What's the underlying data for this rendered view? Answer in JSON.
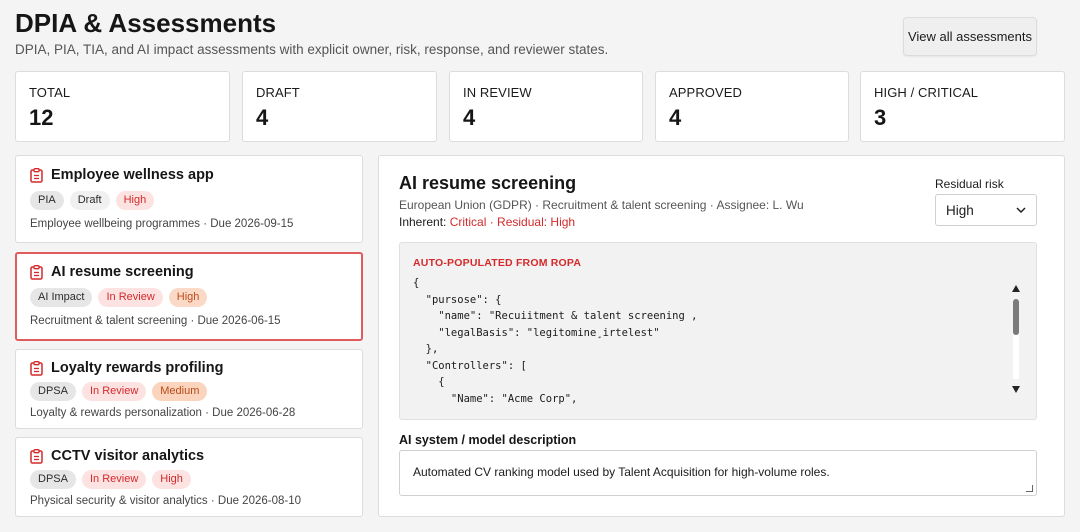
{
  "header": {
    "title": "DPIA & Assessments",
    "subtitle": "DPIA, PIA, TIA, and AI impact assessments with explicit owner, risk, response, and reviewer states.",
    "view_all_label": "View all assessments"
  },
  "stats": [
    {
      "label": "TOTAL",
      "value": "12"
    },
    {
      "label": "DRAFT",
      "value": "4"
    },
    {
      "label": "IN REVIEW",
      "value": "4"
    },
    {
      "label": "APPROVED",
      "value": "4"
    },
    {
      "label": "HIGH / CRITICAL",
      "value": "3"
    }
  ],
  "assessments": [
    {
      "name": "Employee wellness app",
      "type": "PIA",
      "status": "Draft",
      "risk": "High",
      "meta": "Employee wellbeing programmes · Due 2026-09-15",
      "selected": false
    },
    {
      "name": "AI resume screening",
      "type": "AI Impact",
      "status": "In Review",
      "risk": "High",
      "meta": "Recruitment & talent screening · Due 2026-06-15",
      "selected": true
    },
    {
      "name": "Loyalty rewards profiling",
      "type": "DPSA",
      "status": "In Review",
      "risk": "Medium",
      "meta": "Loyalty & rewards personalization · Due 2026-06-28",
      "selected": false
    },
    {
      "name": "CCTV visitor analytics",
      "type": "DPSA",
      "status": "In Review",
      "risk": "High",
      "meta": "Physical security & visitor analytics · Due 2026-08-10",
      "selected": false
    }
  ],
  "icons": {
    "assessment": "clipboard-icon",
    "select": "chevron-down-icon"
  },
  "colors": {
    "accent_red": "#d42a2a",
    "selected_border": "#e05b5b",
    "high_bg": "#fbd9c7",
    "review_bg": "#fde2e2"
  },
  "detail": {
    "title": "AI resume screening",
    "subtitle": "European Union (GDPR) · Recruitment & talent screening · Assignee: L. Wu",
    "inherent_label": "Inherent: ",
    "inherent_value": "Critical · Residual: High",
    "residual_label": "Residual risk",
    "residual_value": "High",
    "ropa_label": "AUTO-POPULATED FROM ROPA",
    "ropa_code": "{\n  \"pursose\": {\n    \"name\": \"Recuiitment & talent screening ,\n    \"legalBasis\": \"legitomine¸irtelest\"\n  },\n  \"Controllers\": [\n    {\n      \"Name\": \"Acme Corp\",",
    "ai_label": "AI system / model description",
    "ai_value": "Automated CV ranking model used by Talent Acquisition for high-volume roles."
  }
}
